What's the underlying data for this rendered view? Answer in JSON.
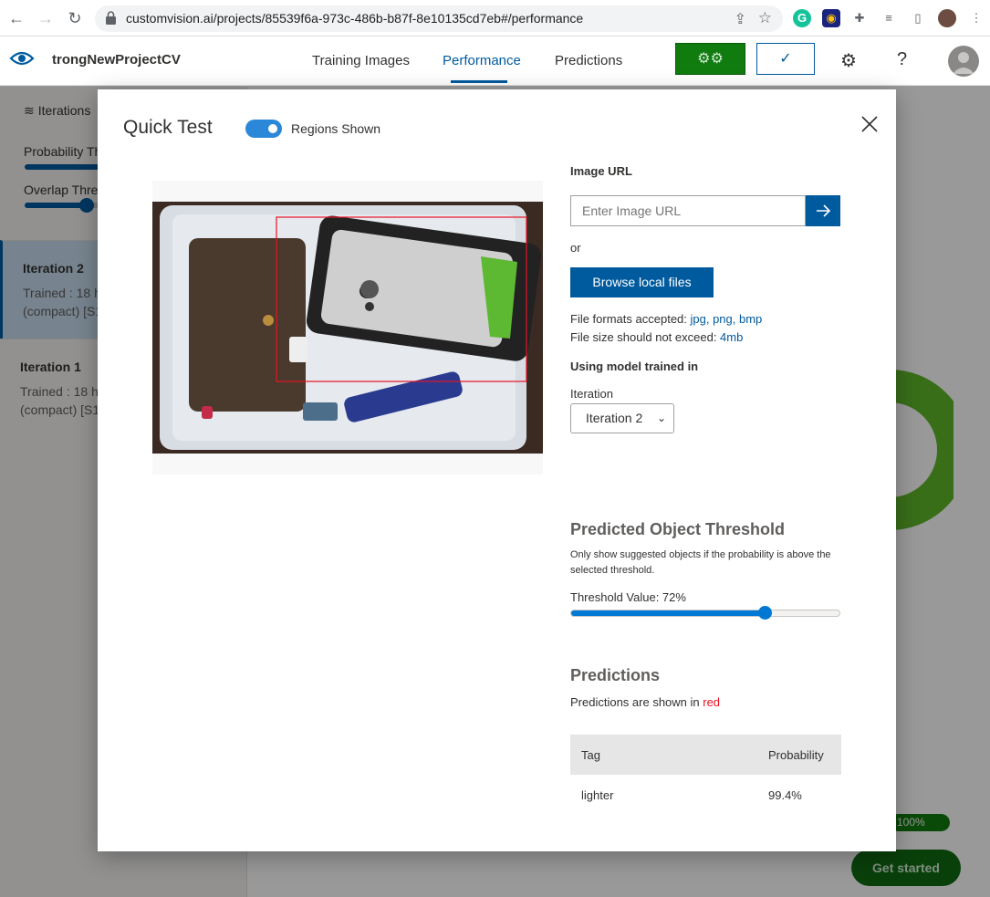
{
  "browser": {
    "url": "customvision.ai/projects/85539f6a-973c-486b-b87f-8e10135cd7eb#/performance"
  },
  "app": {
    "project_name": "trongNewProjectCV",
    "tabs": [
      {
        "label": "Training Images"
      },
      {
        "label": "Performance"
      },
      {
        "label": "Predictions"
      }
    ],
    "publish_symbol": "✓"
  },
  "sidebar": {
    "title": "Iterations",
    "probability_label": "Probability Th",
    "overlap_label": "Overlap Thre",
    "iterations": [
      {
        "name": "Iteration 2",
        "line1": "Trained : 18 h",
        "line2": "(compact) [S1"
      },
      {
        "name": "Iteration 1",
        "line1": "Trained : 18 h",
        "line2": "(compact) [S1"
      }
    ]
  },
  "background": {
    "progress_text": "100%",
    "get_started": "Get started"
  },
  "modal": {
    "title": "Quick Test",
    "toggle_label": "Regions Shown",
    "image_url_label": "Image URL",
    "url_placeholder": "Enter Image URL",
    "or_text": "or",
    "browse_button": "Browse local files",
    "formats_prefix": "File formats accepted: ",
    "formats": "jpg, png, bmp",
    "size_prefix": "File size should not exceed: ",
    "size_value": "4mb",
    "using_model": "Using model trained in",
    "iteration_label": "Iteration",
    "iteration_selected": "Iteration 2",
    "threshold_title": "Predicted Object Threshold",
    "threshold_desc": "Only show suggested objects if the probability is above the selected threshold.",
    "threshold_label": "Threshold Value: 72%",
    "threshold_value": 0.72,
    "predictions_title": "Predictions",
    "predictions_note_prefix": "Predictions are shown in ",
    "predictions_note_color": "red",
    "table": {
      "headers": [
        "Tag",
        "Probability"
      ],
      "rows": [
        [
          "lighter",
          "99.4%"
        ]
      ]
    }
  },
  "colors": {
    "accent": "#005a9e",
    "train_green": "#107c10",
    "region_box": "#e81123",
    "toggle": "#2b88d8"
  }
}
